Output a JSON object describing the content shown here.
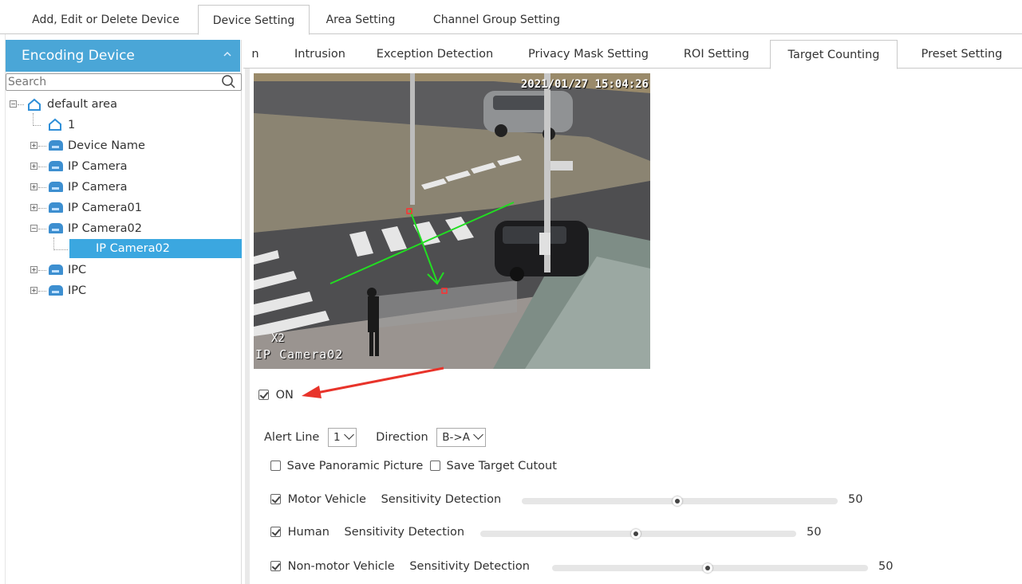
{
  "top_tabs": [
    "Add, Edit or Delete Device",
    "Device Setting",
    "Area Setting",
    "Channel Group Setting"
  ],
  "left": {
    "header": "Encoding Device",
    "search_placeholder": "Search",
    "tree": {
      "root": "default area",
      "area_child": "1",
      "devices": [
        "Device Name",
        "IP Camera",
        "IP Camera",
        "IP Camera01",
        "IP Camera02"
      ],
      "selected_channel": "IP Camera02",
      "more_devices": [
        "IPC",
        "IPC"
      ]
    }
  },
  "sub_tabs": [
    "n",
    "Intrusion",
    "Exception Detection",
    "Privacy Mask Setting",
    "ROI Setting",
    "Target Counting",
    "Preset Setting"
  ],
  "video": {
    "timestamp": "2021/01/27  15:04:26",
    "zoom": "X2",
    "camera_label": "IP Camera02"
  },
  "on_label": "ON",
  "on_checked": true,
  "alert_line_label": "Alert Line",
  "alert_line_value": "1",
  "direction_label": "Direction",
  "direction_value": "B->A",
  "save_panoramic_label": "Save Panoramic Picture",
  "save_panoramic_checked": false,
  "save_cutout_label": "Save Target Cutout",
  "save_cutout_checked": false,
  "targets": [
    {
      "label": "Motor Vehicle",
      "checked": true,
      "sens_label": "Sensitivity Detection",
      "value": "50",
      "level": 0.5
    },
    {
      "label": "Human",
      "checked": true,
      "sens_label": "Sensitivity Detection",
      "value": "50",
      "level": 0.5
    },
    {
      "label": "Non-motor Vehicle",
      "checked": true,
      "sens_label": "Sensitivity Detection",
      "value": "50",
      "level": 0.5
    }
  ],
  "colors": {
    "accent": "#4aa6d7",
    "selected": "#3ba7e0",
    "alert_line": "#22dd22",
    "arrow_red": "#e8332a"
  }
}
